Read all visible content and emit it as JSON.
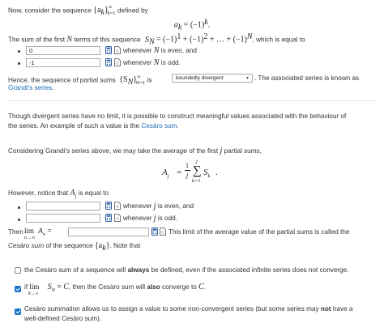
{
  "intro": {
    "text_before": "Now, consider the sequence",
    "seq": "{a",
    "seq_sub": "k",
    "seq_close": "}",
    "seq_sup": "∞",
    "seq_lower": "k=1",
    "text_after": "defined by"
  },
  "formula1": {
    "lhs": "a",
    "lhs_sub": "k",
    "eq": " = (−1)",
    "exp": "k",
    "end": "."
  },
  "sum_line": {
    "text": "The sum of the first",
    "n": "N",
    "text2": "terms of this sequence",
    "s": "S",
    "s_sub": "N",
    "rhs": "= (−1)",
    "e1": "1",
    "p2": " + (−1)",
    "e2": "2",
    "p3": " + … + (−1)",
    "eN": "N",
    "end": ", which is equal to"
  },
  "case1": {
    "value": "0",
    "after": "whenever",
    "var": "N",
    "after2": "is even, and"
  },
  "case2": {
    "value": "-1",
    "after": "whenever",
    "var": "N",
    "after2": "is odd."
  },
  "hence": {
    "text": "Hence, the sequence of partial sums",
    "s": "{S",
    "s_sub": "N",
    "s_close": "}",
    "sup": "∞",
    "lower": "N=1",
    "is": "is",
    "select_value": "boundedly divergent",
    "after": ". The associated series is known as",
    "link": "Grandi's series",
    "end": "."
  },
  "para2": {
    "line1": "Though divergent series have no limit, it is possible to construct meaningful values associated with the behaviour of",
    "line2": "the series. An example of such a value is the",
    "link": "Cesàro sum",
    "end": "."
  },
  "para3": {
    "text": "Considering Grandi's series above, we may take the",
    "em": "average",
    "text2": "of the first",
    "j": "j",
    "text3": "partial sums,"
  },
  "formula2": {
    "lhs": "A",
    "lhs_sub": "j",
    "eq": "=",
    "num": "1",
    "den": "j",
    "sum_top": "j",
    "sum": "∑",
    "sum_bot": "k=1",
    "term": "S",
    "term_sub": "k",
    "end": "."
  },
  "however": {
    "text": "However, notice that",
    "a": "A",
    "a_sub": "j",
    "text2": "is equal to"
  },
  "case3": {
    "value": "",
    "after": "whenever",
    "var": "j",
    "after2": "is even, and"
  },
  "case4": {
    "value": "",
    "after": "whenever",
    "var": "j",
    "after2": "is odd."
  },
  "then": {
    "text": "Then",
    "lim": "lim",
    "lim_sub": "n→∞",
    "a": "A",
    "a_sub": "n",
    "eq": "=",
    "value": "",
    "after": "This limit of the",
    "em": "average",
    "after2": "value of the partial sums is called the"
  },
  "then2": {
    "em": "Cesàro sum",
    "text": "of the sequence",
    "seq": "{a",
    "seq_sub": "k",
    "seq_close": "}",
    "end": ". Note that"
  },
  "options": [
    {
      "checked": false,
      "pre": "the Cesàro sum of a sequence will",
      "bold": "always",
      "post": "be defined, even if the associated infinite series does not converge."
    },
    {
      "checked": true,
      "pre": "if",
      "lim": "lim",
      "lim_sub": "N→∞",
      "s": "S",
      "s_sub": "N",
      "eq": "=",
      "c": "C",
      "mid": ", then the Cesàro sum will",
      "bold": "also",
      "post": "converge to",
      "c2": "C",
      "end": "."
    },
    {
      "checked": true,
      "line1_pre": "Cesàro summation allows us to assign a value to some non-convergent series (but some series may",
      "bold": "not",
      "line1_post": "have a",
      "line2": "well-defined Cesàro sum)."
    }
  ],
  "colors": {
    "link": "#1f6fb5",
    "checkbox": "#1a73c8",
    "icon": "#2c5aa0"
  }
}
